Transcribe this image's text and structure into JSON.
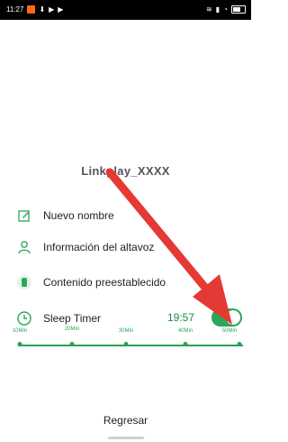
{
  "status_bar": {
    "time": "11:27",
    "left_icons": [
      "orange-app-badge",
      "notification-icon",
      "play-icon",
      "play-icon"
    ],
    "right_icons": [
      "vibrate-icon",
      "signal-icon",
      "wifi-icon",
      "battery-icon"
    ]
  },
  "device": {
    "name": "Linkplay_XXXX"
  },
  "menu": {
    "rename": "Nuevo nombre",
    "speaker_info": "Información del altavoz",
    "presets": "Contenido preestablecido",
    "sleep_timer": "Sleep Timer",
    "sleep_timer_value": "19:57"
  },
  "sleep_timer_options": [
    "10Min",
    "20Min",
    "30Min",
    "40Min",
    "50Min"
  ],
  "sleep_timer_enabled": true,
  "footer": {
    "back": "Regresar"
  },
  "colors": {
    "accent": "#27a957",
    "arrow": "#e53935"
  }
}
